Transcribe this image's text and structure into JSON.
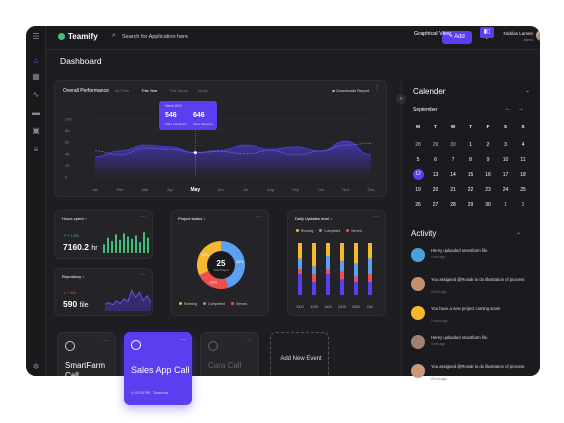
{
  "app": {
    "name": "Teamify"
  },
  "topbar": {
    "search_placeholder": "Search for Application here",
    "add_label": "+ Add",
    "user_name": "Nicklas Larsen",
    "user_role": "admin"
  },
  "page": {
    "title": "Dashboard",
    "view_label": "Graphical View"
  },
  "performance": {
    "title": "Overall Performance",
    "tabs": [
      "All Time",
      "This Year",
      "This Week",
      "Today"
    ],
    "active_tab": "This Year",
    "download_label": "Downloads Report",
    "tooltip": {
      "date": "March 2019",
      "value1": "546",
      "label1": "Tasks Completed",
      "value2": "646",
      "label2": "Tasks Assigned"
    }
  },
  "chart_data": {
    "type": "line",
    "categories": [
      "Jan",
      "Feb",
      "Mar",
      "Apr",
      "May",
      "Jun",
      "Jul",
      "Aug",
      "Sep",
      "Oct",
      "Nov",
      "Dec"
    ],
    "yticks": [
      0,
      20,
      40,
      60,
      80,
      100
    ],
    "ylim": [
      0,
      100
    ],
    "highlight": "May",
    "series": [
      {
        "values": [
          35,
          45,
          55,
          52,
          42,
          46,
          55,
          48,
          52,
          45,
          62,
          38
        ],
        "color": "#4d3bd6",
        "fill": true
      },
      {
        "values": [
          45,
          38,
          50,
          48,
          42,
          44,
          40,
          46,
          38,
          45,
          55,
          58
        ],
        "color": "#7a6cf0",
        "dashed": true
      }
    ]
  },
  "hours": {
    "title": "Hours spent",
    "change": "+ 1.8%",
    "value": "7160.2",
    "unit": "hr",
    "bars": [
      40,
      70,
      55,
      85,
      60,
      90,
      75,
      65,
      80,
      50,
      95,
      70
    ]
  },
  "repo": {
    "title": "Repository",
    "change": "+ 8%",
    "value": "590",
    "unit": "file",
    "wave": [
      20,
      25,
      18,
      30,
      22,
      35,
      28,
      60,
      40,
      55,
      30,
      45,
      25
    ]
  },
  "project": {
    "title": "Project status",
    "total": "25",
    "total_label": "Total Project",
    "segments": [
      {
        "label": "45%",
        "value": 45,
        "color": "#5ea0f0"
      },
      {
        "label": "23%",
        "value": 23,
        "color": "#ef4f4f"
      },
      {
        "label": "32%",
        "value": 32,
        "color": "#f5b82e"
      }
    ],
    "legend": [
      {
        "name": "Running",
        "color": "#f5b82e"
      },
      {
        "name": "Completed",
        "color": "#5ea0f0"
      },
      {
        "name": "Served",
        "color": "#ef4f4f"
      }
    ]
  },
  "daily": {
    "title": "Daily Updates level",
    "legend": [
      {
        "name": "Running",
        "color": "#f5b82e"
      },
      {
        "name": "Completed",
        "color": "#5ea0f0"
      },
      {
        "name": "Served",
        "color": "#ef4f4f"
      }
    ],
    "labels": [
      "11/0",
      "12/0",
      "14/0",
      "21/0",
      "28/0",
      "04/"
    ],
    "bars": [
      [
        30,
        20,
        10,
        40
      ],
      [
        45,
        15,
        15,
        25
      ],
      [
        25,
        25,
        10,
        40
      ],
      [
        35,
        20,
        15,
        30
      ],
      [
        40,
        25,
        10,
        25
      ],
      [
        30,
        30,
        15,
        25
      ]
    ]
  },
  "calendar": {
    "title": "Calender",
    "month": "September",
    "dow": [
      "M",
      "T",
      "W",
      "T",
      "F",
      "S",
      "S"
    ],
    "weeks": [
      [
        "28",
        "29",
        "30",
        "1",
        "2",
        "3",
        "4"
      ],
      [
        "5",
        "6",
        "7",
        "8",
        "9",
        "10",
        "11"
      ],
      [
        "12",
        "13",
        "14",
        "15",
        "16",
        "17",
        "18"
      ],
      [
        "19",
        "20",
        "21",
        "22",
        "23",
        "24",
        "25"
      ],
      [
        "26",
        "27",
        "28",
        "29",
        "30",
        "1",
        "2"
      ]
    ],
    "selected": "12"
  },
  "activity": {
    "title": "Activity",
    "items": [
      {
        "text": "Henry uploaded smartfarm file.",
        "time": "4 min ago",
        "color": "#4aa3d8"
      },
      {
        "text": "You assigned @Ronak to do illustration of process",
        "time": "25 min ago",
        "color": "#c8906a"
      },
      {
        "text": "You have a new project coming soon!",
        "time": "2 hours ago",
        "color": "#f5b82e"
      },
      {
        "text": "Henry uploaded smartfarm file.",
        "time": "4 min ago",
        "color": "#a08070"
      },
      {
        "text": "You assigned @Ronak to do illustration of process",
        "time": "25 min ago",
        "color": "#c89a7a"
      }
    ]
  },
  "bottom": {
    "card1": "SmartFarm Call",
    "card2": "Sales App Call",
    "card2_time": "02:00 PM",
    "card2_when": "Tomorrow",
    "card3": "Cara Call",
    "card4": "Add New Event"
  }
}
